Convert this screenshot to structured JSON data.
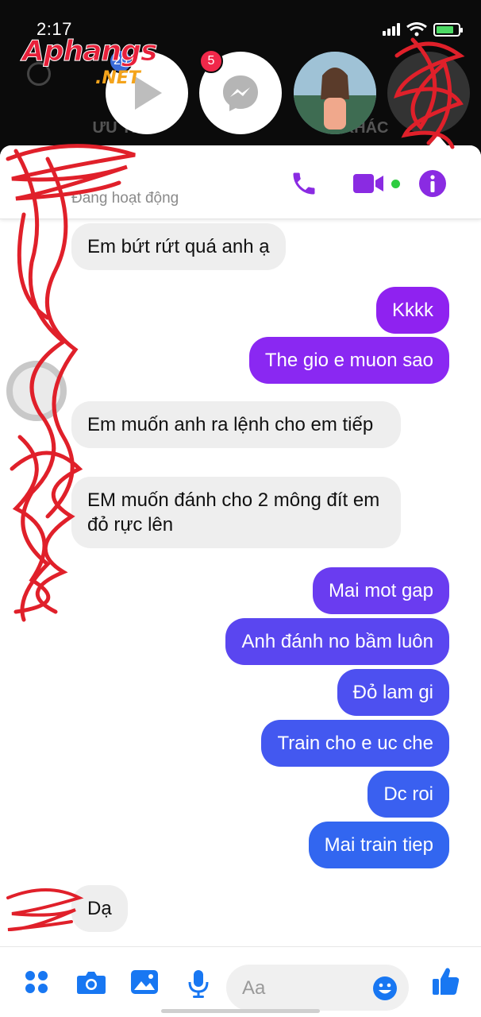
{
  "status_bar": {
    "time": "2:17"
  },
  "watermark": {
    "brand": "Aphangs",
    "suffix": ".NET"
  },
  "background": {
    "tabs": [
      "ƯU TIÊN",
      "KHÁC"
    ]
  },
  "chat_heads": {
    "badge_1": "20",
    "badge_2": "5"
  },
  "header": {
    "status": "Đang hoạt động"
  },
  "messages": [
    {
      "dir": "in",
      "text": "Em bứt rứt quá anh ạ"
    },
    {
      "dir": "out",
      "text": "Kkkk"
    },
    {
      "dir": "out",
      "text": "The gio e muon sao"
    },
    {
      "dir": "in",
      "text": "Em muốn anh ra lệnh cho em tiếp"
    },
    {
      "dir": "in",
      "text": "EM muốn đánh cho 2 mông đít em đỏ rực lên"
    },
    {
      "dir": "out",
      "text": "Mai mot gap"
    },
    {
      "dir": "out",
      "text": "Anh đánh no bầm luôn"
    },
    {
      "dir": "out",
      "text": "Đỏ lam gi"
    },
    {
      "dir": "out",
      "text": "Train  cho e uc che"
    },
    {
      "dir": "out",
      "text": "Dc roi"
    },
    {
      "dir": "out",
      "text": "Mai train tiep"
    },
    {
      "dir": "in",
      "text": "Dạ"
    }
  ],
  "composer": {
    "placeholder": "Aa"
  },
  "colors": {
    "accent": "#8a2be2",
    "outgoing_top": "#8f22f0",
    "outgoing_bottom": "#2f6cf0",
    "incoming_bg": "#eeeeee",
    "toolbar_blue": "#1877f2",
    "censor_red": "#e0202a"
  },
  "icons": [
    "phone-icon",
    "video-call-icon",
    "info-icon",
    "apps-grid-icon",
    "camera-icon",
    "gallery-icon",
    "microphone-icon",
    "emoji-icon",
    "thumbs-up-icon"
  ]
}
